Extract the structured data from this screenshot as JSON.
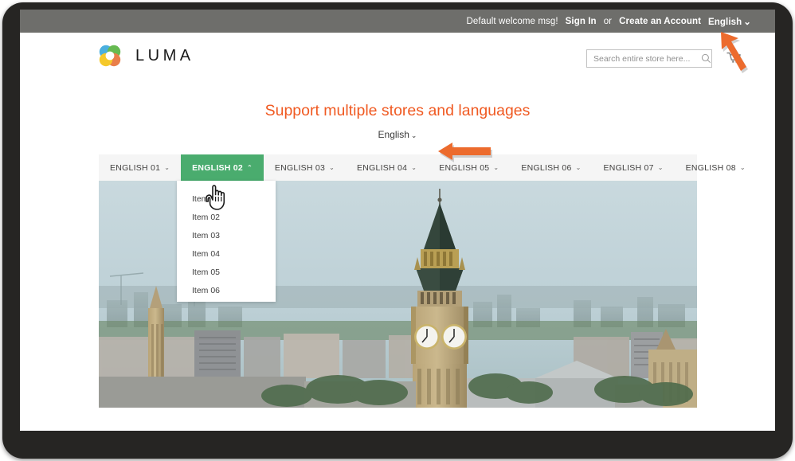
{
  "topbar": {
    "welcome_msg": "Default welcome msg!",
    "sign_in": "Sign In",
    "or": "or",
    "create_account": "Create an Account",
    "language": "English",
    "chevron": "⌄"
  },
  "header": {
    "logo_text": "LUMA",
    "logo_colors": {
      "blue": "#3ba9dd",
      "green": "#5ab543",
      "orange": "#e8743b",
      "yellow": "#f5c518"
    }
  },
  "search": {
    "placeholder": "Search entire store here...",
    "value": "",
    "search_icon": "search-icon",
    "cart_icon": "cart-icon"
  },
  "hero": {
    "title": "Support multiple stores and languages",
    "title_color": "#f05a22",
    "language_label": "English",
    "language_chevron": "⌄"
  },
  "nav": {
    "active_index": 1,
    "items": [
      {
        "label": "ENGLISH 01",
        "chevron": "⌄"
      },
      {
        "label": "ENGLISH 02",
        "chevron": "⌃"
      },
      {
        "label": "ENGLISH 03",
        "chevron": "⌄"
      },
      {
        "label": "ENGLISH 04",
        "chevron": "⌄"
      },
      {
        "label": "ENGLISH 05",
        "chevron": "⌄"
      },
      {
        "label": "ENGLISH 06",
        "chevron": "⌄"
      },
      {
        "label": "ENGLISH 07",
        "chevron": "⌄"
      },
      {
        "label": "ENGLISH 08",
        "chevron": "⌄"
      }
    ],
    "active_bg": "#4aac6e",
    "bar_bg": "#f5f5f5"
  },
  "dropdown": {
    "items": [
      {
        "label": "Item 01"
      },
      {
        "label": "Item 02"
      },
      {
        "label": "Item 03"
      },
      {
        "label": "Item 04"
      },
      {
        "label": "Item 05"
      },
      {
        "label": "Item 06"
      }
    ]
  },
  "cursor": {
    "icon": "pointing-hand-cursor"
  },
  "annotations": [
    {
      "name": "arrow-to-language-switcher",
      "direction": "up-left",
      "color": "#ec6b2d"
    },
    {
      "name": "arrow-to-store-language-select",
      "direction": "left",
      "color": "#ec6b2d"
    }
  ],
  "hero_image": {
    "alt": "Aerial photograph of London with Big Ben clock tower",
    "sky_color": "#c3d4da",
    "city_color": "#9aa6a8"
  }
}
